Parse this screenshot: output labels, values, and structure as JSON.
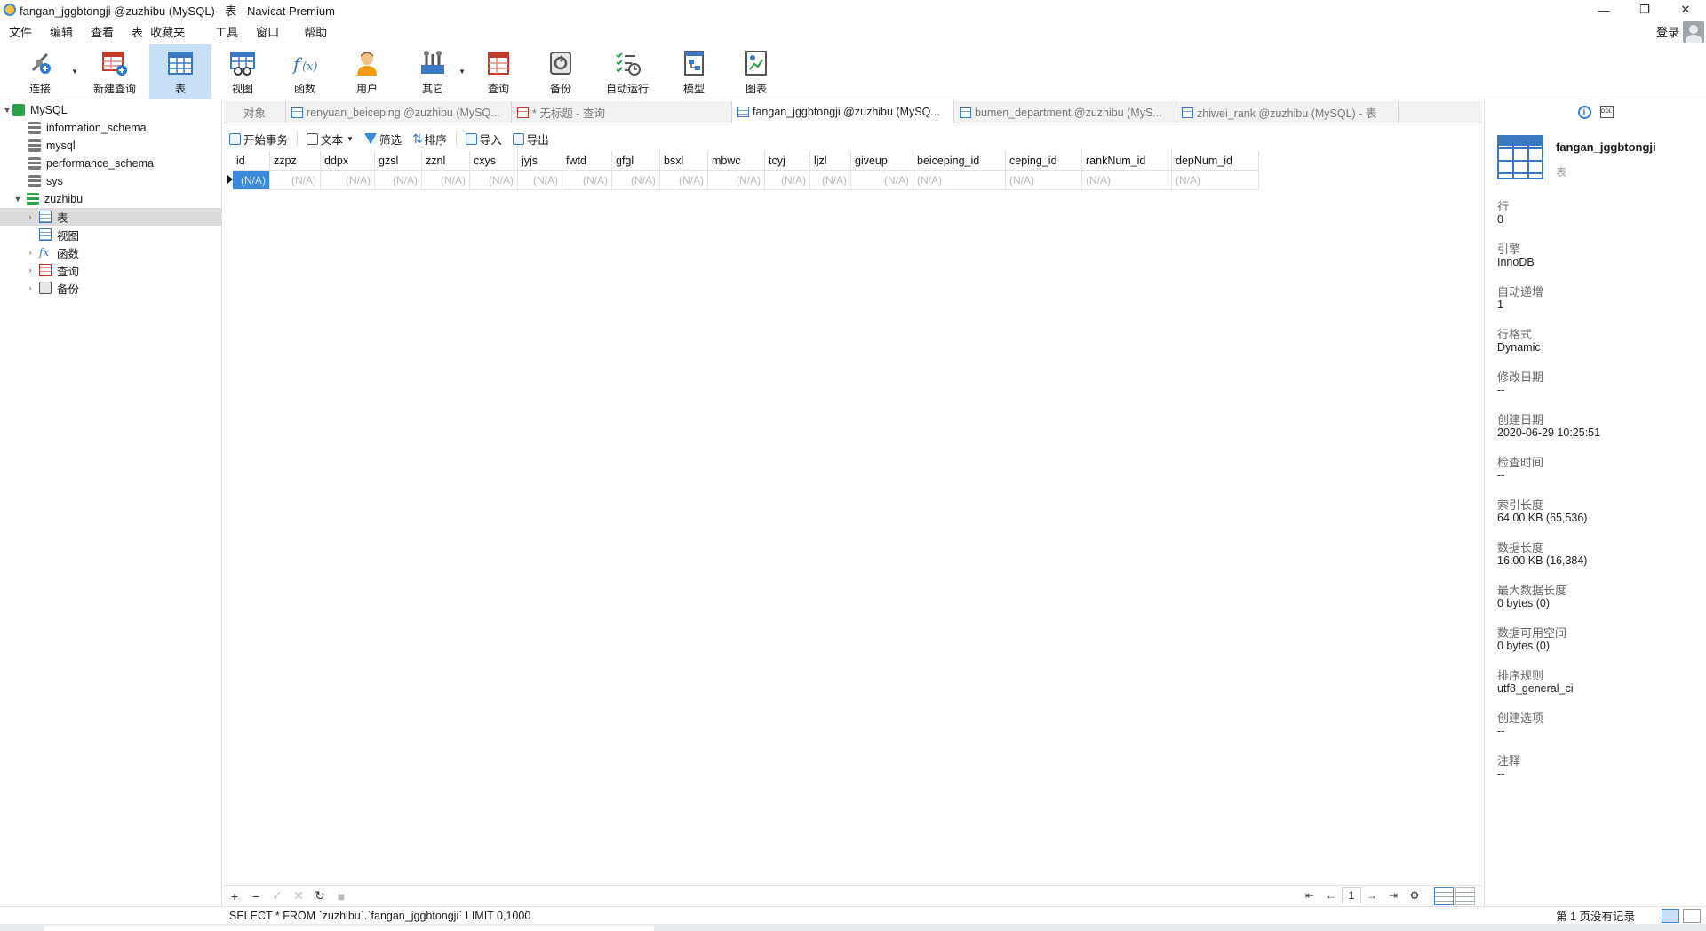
{
  "window": {
    "title": "fangan_jggbtongji @zuzhibu (MySQL) - 表 - Navicat Premium",
    "controls": [
      "—",
      "❐",
      "✕"
    ]
  },
  "menubar": {
    "items": [
      "文件",
      "编辑",
      "查看",
      "表",
      "收藏夹",
      "工具",
      "窗口",
      "帮助"
    ],
    "login": "登录"
  },
  "toolbar": {
    "items": [
      {
        "label": "连接",
        "icon": "connect-icon"
      },
      {
        "label": "新建查询",
        "icon": "new-query-icon"
      },
      {
        "label": "表",
        "icon": "table-icon",
        "active": true
      },
      {
        "label": "视图",
        "icon": "view-icon"
      },
      {
        "label": "函数",
        "icon": "function-icon"
      },
      {
        "label": "用户",
        "icon": "user-icon"
      },
      {
        "label": "其它",
        "icon": "tools-icon"
      },
      {
        "label": "查询",
        "icon": "query-icon"
      },
      {
        "label": "备份",
        "icon": "backup-icon"
      },
      {
        "label": "自动运行",
        "icon": "schedule-icon"
      },
      {
        "label": "模型",
        "icon": "model-icon"
      },
      {
        "label": "图表",
        "icon": "chart-icon"
      }
    ]
  },
  "nav": {
    "root": "MySQL",
    "databases": [
      "information_schema",
      "mysql",
      "performance_schema",
      "sys",
      "zuzhibu"
    ],
    "children": [
      "表",
      "视图",
      "函数",
      "查询",
      "备份"
    ]
  },
  "tabs": [
    {
      "label": "对象"
    },
    {
      "label": "renyuan_beiceping @zuzhibu (MySQ..."
    },
    {
      "label": "* 无标题 - 查询"
    },
    {
      "label": "fangan_jggbtongji @zuzhibu (MySQ...",
      "active": true
    },
    {
      "label": "bumen_department @zuzhibu (MyS..."
    },
    {
      "label": "zhiwei_rank @zuzhibu (MySQL) - 表"
    }
  ],
  "objtoolbar": {
    "begin_tx": "开始事务",
    "text": "文本",
    "filter": "筛选",
    "sort": "排序",
    "import": "导入",
    "export": "导出"
  },
  "grid": {
    "columns": [
      "id",
      "zzpz",
      "ddpx",
      "gzsl",
      "zznl",
      "cxys",
      "jyjs",
      "fwtd",
      "gfgl",
      "bsxl",
      "mbwc",
      "tcyj",
      "ljzl",
      "giveup",
      "beiceping_id",
      "ceping_id",
      "rankNum_id",
      "depNum_id"
    ],
    "row": [
      "(N/A)",
      "(N/A)",
      "(N/A)",
      "(N/A)",
      "(N/A)",
      "(N/A)",
      "(N/A)",
      "(N/A)",
      "(N/A)",
      "(N/A)",
      "(N/A)",
      "(N/A)",
      "(N/A)",
      "(N/A)",
      "(N/A)",
      "(N/A)",
      "(N/A)",
      "(N/A)"
    ]
  },
  "gridbottom": {
    "page": "1"
  },
  "info": {
    "name": "fangan_jggbtongji",
    "type": "表",
    "props": [
      {
        "label": "行",
        "value": "0"
      },
      {
        "label": "引擎",
        "value": "InnoDB"
      },
      {
        "label": "自动递增",
        "value": "1"
      },
      {
        "label": "行格式",
        "value": "Dynamic"
      },
      {
        "label": "修改日期",
        "value": "--"
      },
      {
        "label": "创建日期",
        "value": "2020-06-29 10:25:51"
      },
      {
        "label": "检查时间",
        "value": "--"
      },
      {
        "label": "索引长度",
        "value": "64.00 KB (65,536)"
      },
      {
        "label": "数据长度",
        "value": "16.00 KB (16,384)"
      },
      {
        "label": "最大数据长度",
        "value": "0 bytes (0)"
      },
      {
        "label": "数据可用空间",
        "value": "0 bytes (0)"
      },
      {
        "label": "排序规则",
        "value": "utf8_general_ci"
      },
      {
        "label": "创建选项",
        "value": "--"
      },
      {
        "label": "注释",
        "value": "--"
      }
    ]
  },
  "status": {
    "sql": "SELECT * FROM `zuzhibu`.`fangan_jggbtongji` LIMIT 0,1000",
    "records": "第 1 页没有记录"
  }
}
